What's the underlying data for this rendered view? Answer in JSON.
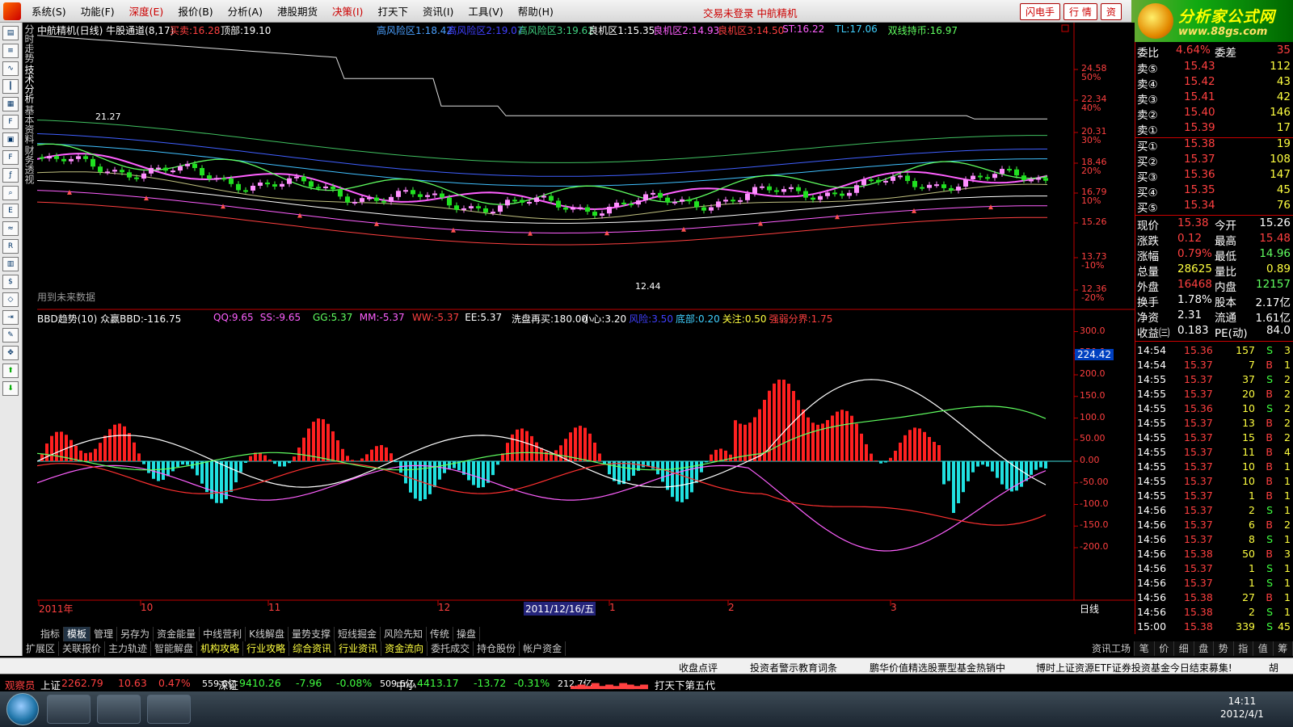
{
  "menu": {
    "items": [
      "系统(S)",
      "功能(F)",
      "深度(E)",
      "报价(B)",
      "分析(A)",
      "港股期货",
      "决策(I)",
      "打天下",
      "资讯(I)",
      "工具(V)",
      "帮助(H)"
    ],
    "red_items": [
      2,
      6
    ],
    "status": "交易未登录  中航精机",
    "buttons": [
      "闪电手",
      "行 情",
      "资"
    ]
  },
  "brand": {
    "title": "分析家公式网",
    "url": "www.88gs.com"
  },
  "left_tabs": [
    "分时走势",
    "技术分析",
    "基本资料",
    "财务透视"
  ],
  "main_chart": {
    "title": "中航精机(日线) 牛股通道(8,17)",
    "sell_label": "买卖:16.28",
    "top_label": "顶部:19.10",
    "indicators": [
      {
        "text": "高风险区1:18.42",
        "color": "#4aa0ff"
      },
      {
        "text": "高风险区2:19.07",
        "color": "#4040ff"
      },
      {
        "text": "高风险区3:19.62",
        "color": "#40d080"
      },
      {
        "text": "良机区1:15.35",
        "color": "#ffffff"
      },
      {
        "text": "良机区2:14.93",
        "color": "#ff60ff"
      },
      {
        "text": "良机区3:14.50",
        "color": "#ff4040"
      },
      {
        "text": "ST:16.22",
        "color": "#ff60ff"
      },
      {
        "text": "TL:17.06",
        "color": "#40d0ff"
      },
      {
        "text": "双线持币:16.97",
        "color": "#60ff60"
      }
    ],
    "y_ticks": [
      {
        "price": "24.58",
        "pct": "50%"
      },
      {
        "price": "22.34",
        "pct": "40%"
      },
      {
        "price": "20.31",
        "pct": "30%"
      },
      {
        "price": "18.46",
        "pct": "20%"
      },
      {
        "price": "16.79",
        "pct": "10%"
      },
      {
        "price": "15.26",
        "pct": ""
      },
      {
        "price": "13.73",
        "pct": "-10%"
      },
      {
        "price": "12.36",
        "pct": "-20%"
      }
    ],
    "high_label": "21.27",
    "low_label": "12.44",
    "future_note": "用到未来数据"
  },
  "sub_chart": {
    "title": "BBD趋势(10) 众赢BBD:-116.75",
    "indicators": [
      {
        "text": "QQ:9.65",
        "color": "#ff60ff"
      },
      {
        "text": "SS:-9.65",
        "color": "#ff60ff"
      },
      {
        "text": "GG:5.37",
        "color": "#60ff60"
      },
      {
        "text": "MM:-5.37",
        "color": "#ff60ff"
      },
      {
        "text": "WW:-5.37",
        "color": "#ff4040"
      },
      {
        "text": "EE:5.37",
        "color": "#ffffff"
      },
      {
        "text": "洗盘再买:180.00",
        "color": "#ffffff"
      },
      {
        "text": "小心:3.20",
        "color": "#ffffff"
      },
      {
        "text": "风险:3.50",
        "color": "#4040ff"
      },
      {
        "text": "底部:0.20",
        "color": "#40d0ff"
      },
      {
        "text": "关注:0.50",
        "color": "#ffff40"
      },
      {
        "text": "强弱分界:1.75",
        "color": "#ff4040"
      }
    ],
    "y_ticks": [
      "300.0",
      "250.0",
      "200.0",
      "150.0",
      "100.0",
      "50.00",
      "0.00",
      "-50.00",
      "-100.0",
      "-150.0",
      "-200.0"
    ],
    "current_value": "224.42"
  },
  "x_axis": {
    "labels": [
      "2011年",
      "10",
      "11",
      "12",
      "1",
      "2",
      "3"
    ],
    "cursor_date": "2011/12/16/五",
    "period": "日线"
  },
  "bottom_tabs": {
    "row1": [
      "指标",
      "模板",
      "管理",
      "另存为",
      "资金能量",
      "中线营利",
      "K线解盘",
      "量势支撑",
      "短线掘金",
      "风险先知",
      "传统",
      "操盘"
    ],
    "row1_active": 1,
    "row2": [
      {
        "text": "扩展区",
        "color": "#cccccc"
      },
      {
        "text": "关联报价",
        "color": "#cccccc"
      },
      {
        "text": "主力轨迹",
        "color": "#cccccc"
      },
      {
        "text": "智能解盘",
        "color": "#cccccc"
      },
      {
        "text": "机构攻略",
        "color": "#ffff40"
      },
      {
        "text": "行业攻略",
        "color": "#ffff40"
      },
      {
        "text": "综合资讯",
        "color": "#ffff40"
      },
      {
        "text": "行业资讯",
        "color": "#ffff40"
      },
      {
        "text": "资金流向",
        "color": "#ffff40"
      },
      {
        "text": "委托成交",
        "color": "#cccccc"
      },
      {
        "text": "持仓股份",
        "color": "#cccccc"
      },
      {
        "text": "帐户资金",
        "color": "#cccccc"
      }
    ],
    "work_tab": "资讯工场",
    "right_tabs": [
      "笔",
      "价",
      "细",
      "盘",
      "势",
      "指",
      "值",
      "筹"
    ]
  },
  "quote": {
    "ratio_label": "委比",
    "ratio": "4.64%",
    "diff_label": "委差",
    "diff": "35",
    "sells": [
      {
        "label": "卖⑤",
        "price": "15.43",
        "vol": "112"
      },
      {
        "label": "卖④",
        "price": "15.42",
        "vol": "43"
      },
      {
        "label": "卖③",
        "price": "15.41",
        "vol": "42"
      },
      {
        "label": "卖②",
        "price": "15.40",
        "vol": "146"
      },
      {
        "label": "卖①",
        "price": "15.39",
        "vol": "17"
      }
    ],
    "buys": [
      {
        "label": "买①",
        "price": "15.38",
        "vol": "19"
      },
      {
        "label": "买②",
        "price": "15.37",
        "vol": "108"
      },
      {
        "label": "买③",
        "price": "15.36",
        "vol": "147"
      },
      {
        "label": "买④",
        "price": "15.35",
        "vol": "45"
      },
      {
        "label": "买⑤",
        "price": "15.34",
        "vol": "76"
      }
    ],
    "stats": [
      {
        "l1": "现价",
        "v1": "15.38",
        "c1": "#ff4040",
        "l2": "今开",
        "v2": "15.26",
        "c2": "#ffffff"
      },
      {
        "l1": "涨跌",
        "v1": "0.12",
        "c1": "#ff4040",
        "l2": "最高",
        "v2": "15.48",
        "c2": "#ff4040"
      },
      {
        "l1": "涨幅",
        "v1": "0.79%",
        "c1": "#ff4040",
        "l2": "最低",
        "v2": "14.96",
        "c2": "#60ff60"
      },
      {
        "l1": "总量",
        "v1": "28625",
        "c1": "#ffff40",
        "l2": "量比",
        "v2": "0.89",
        "c2": "#ffff40"
      },
      {
        "l1": "外盘",
        "v1": "16468",
        "c1": "#ff4040",
        "l2": "内盘",
        "v2": "12157",
        "c2": "#60ff60"
      },
      {
        "l1": "换手",
        "v1": "1.78%",
        "c1": "#ffffff",
        "l2": "股本",
        "v2": "2.17亿",
        "c2": "#ffffff"
      },
      {
        "l1": "净资",
        "v1": "2.31",
        "c1": "#ffffff",
        "l2": "流通",
        "v2": "1.61亿",
        "c2": "#ffffff"
      },
      {
        "l1": "收益㈢",
        "v1": "0.183",
        "c1": "#ffffff",
        "l2": "PE(动)",
        "v2": "84.0",
        "c2": "#ffffff"
      }
    ]
  },
  "ticks": [
    {
      "t": "14:54",
      "p": "15.36",
      "v": "157",
      "d": "S",
      "n": "3"
    },
    {
      "t": "14:54",
      "p": "15.37",
      "v": "7",
      "d": "B",
      "n": "1"
    },
    {
      "t": "14:55",
      "p": "15.37",
      "v": "37",
      "d": "S",
      "n": "2"
    },
    {
      "t": "14:55",
      "p": "15.37",
      "v": "20",
      "d": "B",
      "n": "2"
    },
    {
      "t": "14:55",
      "p": "15.36",
      "v": "10",
      "d": "S",
      "n": "2"
    },
    {
      "t": "14:55",
      "p": "15.37",
      "v": "13",
      "d": "B",
      "n": "2"
    },
    {
      "t": "14:55",
      "p": "15.37",
      "v": "15",
      "d": "B",
      "n": "2"
    },
    {
      "t": "14:55",
      "p": "15.37",
      "v": "11",
      "d": "B",
      "n": "4"
    },
    {
      "t": "14:55",
      "p": "15.37",
      "v": "10",
      "d": "B",
      "n": "1"
    },
    {
      "t": "14:55",
      "p": "15.37",
      "v": "10",
      "d": "B",
      "n": "1"
    },
    {
      "t": "14:55",
      "p": "15.37",
      "v": "1",
      "d": "B",
      "n": "1"
    },
    {
      "t": "14:56",
      "p": "15.37",
      "v": "2",
      "d": "S",
      "n": "1"
    },
    {
      "t": "14:56",
      "p": "15.37",
      "v": "6",
      "d": "B",
      "n": "2"
    },
    {
      "t": "14:56",
      "p": "15.37",
      "v": "8",
      "d": "S",
      "n": "1"
    },
    {
      "t": "14:56",
      "p": "15.38",
      "v": "50",
      "d": "B",
      "n": "3"
    },
    {
      "t": "14:56",
      "p": "15.37",
      "v": "1",
      "d": "S",
      "n": "1"
    },
    {
      "t": "14:56",
      "p": "15.37",
      "v": "1",
      "d": "S",
      "n": "1"
    },
    {
      "t": "14:56",
      "p": "15.38",
      "v": "27",
      "d": "B",
      "n": "1"
    },
    {
      "t": "14:56",
      "p": "15.38",
      "v": "2",
      "d": "S",
      "n": "1"
    },
    {
      "t": "15:00",
      "p": "15.38",
      "v": "339",
      "d": "S",
      "n": "45"
    }
  ],
  "news": [
    "收盘点评",
    "投资者警示教育词条",
    "鹏华价值精选股票型基金热销中",
    "博时上证资源ETF证券投资基金今日结束募集!",
    "胡"
  ],
  "index_bar": {
    "watch": "观察员",
    "items": [
      {
        "name": "上证",
        "value": "2262.79",
        "chg": "10.63",
        "pct": "0.47%",
        "amt": "559.6亿",
        "up": true
      },
      {
        "name": "深证",
        "value": "9410.26",
        "chg": "-7.96",
        "pct": "-0.08%",
        "amt": "509.6亿",
        "up": false
      },
      {
        "name": "中小",
        "value": "4413.17",
        "chg": "-13.72",
        "pct": "-0.31%",
        "amt": "212.7亿",
        "up": false
      }
    ],
    "ticker": "打天下第五代"
  },
  "taskbar": {
    "time": "14:11",
    "date": "2012/4/1"
  },
  "colors": {
    "up": "#ff3030",
    "down": "#40e0e0",
    "axis": "#c00000"
  }
}
